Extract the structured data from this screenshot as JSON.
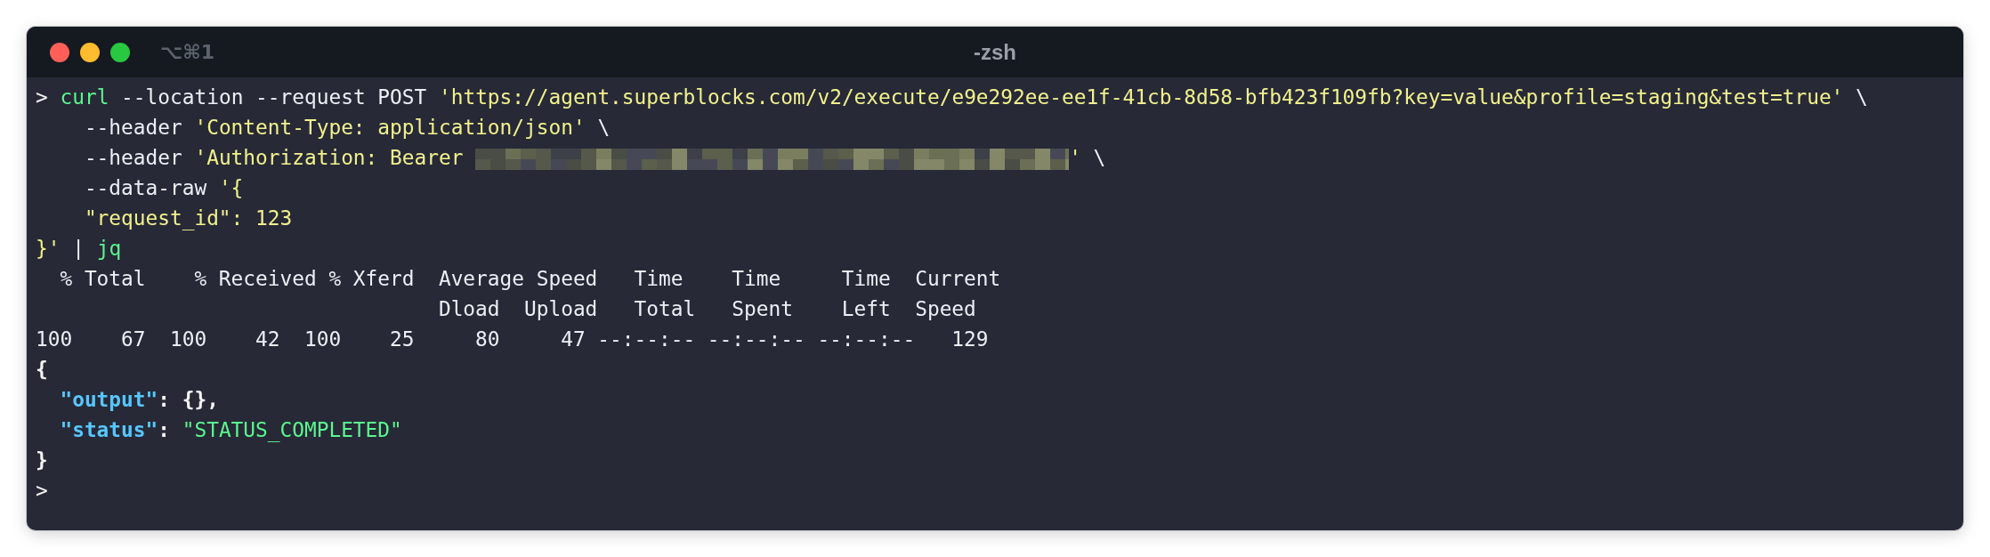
{
  "window": {
    "title": "-zsh",
    "shortcut": "⌥⌘1",
    "controls": [
      {
        "color": "#ff5f57"
      },
      {
        "color": "#febc2e"
      },
      {
        "color": "#28c840"
      }
    ]
  },
  "lines": [
    {
      "segments": [
        {
          "kind": "prompt",
          "text": ">"
        },
        {
          "kind": "command",
          "text": "curl"
        },
        {
          "kind": "plain",
          "text": "--location --request POST"
        },
        {
          "kind": "string",
          "text": "'https://agent.superblocks.com/v2/execute/e9e292ee-ee1f-41cb-8d58-bfb423f109fb?key=value&profile=staging&test=true'"
        },
        {
          "kind": "plain",
          "text": "\\"
        }
      ]
    },
    {
      "segments": [
        {
          "kind": "plain",
          "text": "    --header"
        },
        {
          "kind": "string",
          "text": "'Content-Type: application/json'"
        },
        {
          "kind": "plain",
          "text": "\\"
        }
      ]
    },
    {
      "segments": [
        {
          "kind": "plain",
          "text": "    --header"
        },
        {
          "kind": "string",
          "text": "'Authorization: Bearer"
        },
        {
          "kind": "redacted"
        },
        {
          "kind": "string_end",
          "text": "'"
        },
        {
          "kind": "plain",
          "text": "\\"
        }
      ]
    },
    {
      "segments": [
        {
          "kind": "plain",
          "text": "    --data-raw"
        },
        {
          "kind": "string",
          "text": "'{"
        }
      ]
    },
    {
      "segments": [
        {
          "kind": "string",
          "text": "    \"request_id\": 123"
        }
      ]
    },
    {
      "segments": [
        {
          "kind": "string_end",
          "text": "}'"
        },
        {
          "kind": "plain",
          "text": "|"
        },
        {
          "kind": "command",
          "text": "jq"
        }
      ]
    },
    {
      "segments": [
        {
          "kind": "plain",
          "text": "  % Total    % Received % Xferd  Average Speed   Time    Time     Time  Current"
        }
      ]
    },
    {
      "segments": [
        {
          "kind": "plain",
          "text": "                                 Dload  Upload   Total   Spent    Left  Speed"
        }
      ]
    },
    {
      "segments": [
        {
          "kind": "plain",
          "text": "100    67  100    42  100    25     80     47 --:--:-- --:--:-- --:--:--   129"
        }
      ]
    },
    {
      "segments": [
        {
          "kind": "bold",
          "text": "{"
        }
      ]
    },
    {
      "segments": [
        {
          "kind": "key",
          "text": "  \"output\""
        },
        {
          "kind": "bold_tight",
          "text": ": {},"
        }
      ]
    },
    {
      "segments": [
        {
          "kind": "key",
          "text": "  \"status\""
        },
        {
          "kind": "bold_tight",
          "text": ":"
        },
        {
          "kind": "value",
          "text": "\"STATUS_COMPLETED\""
        }
      ]
    },
    {
      "segments": [
        {
          "kind": "bold",
          "text": "}"
        }
      ]
    },
    {
      "segments": [
        {
          "kind": "prompt",
          "text": ">"
        }
      ]
    }
  ]
}
